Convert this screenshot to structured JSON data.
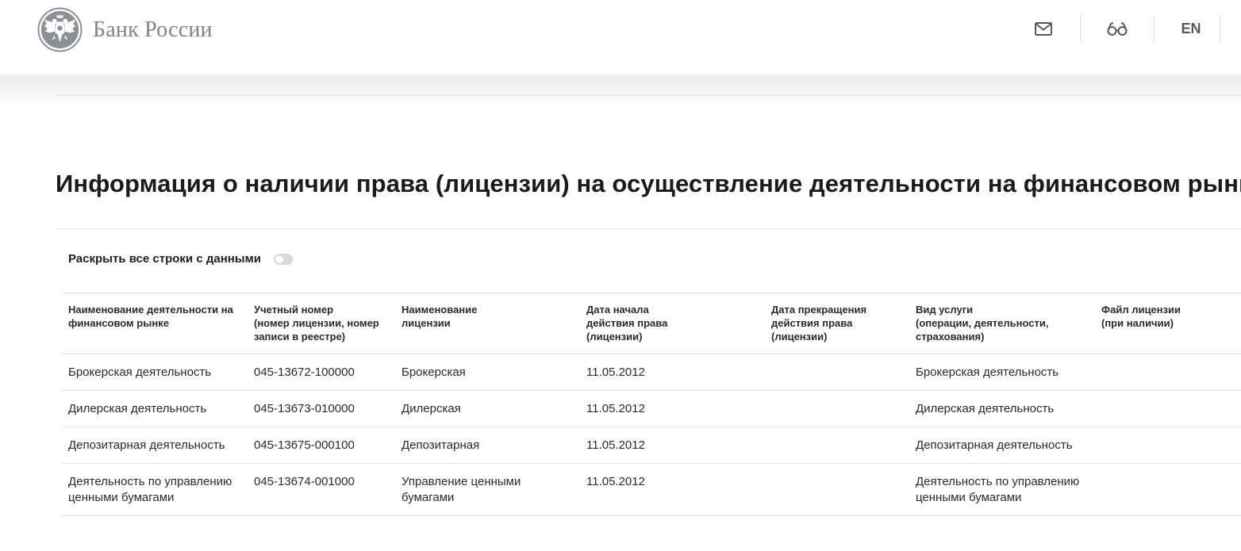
{
  "header": {
    "brand_name": "Банк России",
    "logo_icon": "double-headed-eagle-emblem",
    "actions": {
      "mail_icon": "envelope-icon",
      "accessibility_icon": "glasses-icon",
      "language_label": "EN"
    }
  },
  "page": {
    "title": "Информация о наличии права (лицензии) на осуществление деятельности на финансовом рынке"
  },
  "toggle": {
    "label": "Раскрыть все строки с данными",
    "checked": false
  },
  "table": {
    "columns": [
      "Наименование деятельности на\nфинансовом рынке",
      "Учетный номер\n(номер лицензии, номер\nзаписи в реестре)",
      "Наименование\nлицензии",
      "Дата начала\nдействия права\n(лицензии)",
      "Дата прекращения\nдействия права\n(лицензии)",
      "Вид услуги\n(операции, деятельности,\nстрахования)",
      "Файл лицензии\n(при наличии)"
    ],
    "rows": [
      [
        "Брокерская деятельность",
        "045-13672-100000",
        "Брокерская",
        "11.05.2012",
        "",
        "Брокерская деятельность",
        ""
      ],
      [
        "Дилерская деятельность",
        "045-13673-010000",
        "Дилерская",
        "11.05.2012",
        "",
        "Дилерская деятельность",
        ""
      ],
      [
        "Депозитарная деятельность",
        "045-13675-000100",
        "Депозитарная",
        "11.05.2012",
        "",
        "Депозитарная деятельность",
        ""
      ],
      [
        "Деятельность по управлению ценными бумагами",
        "045-13674-001000",
        "Управление ценными бумагами",
        "11.05.2012",
        "",
        "Деятельность по управлению ценными бумагами",
        ""
      ]
    ]
  },
  "colors": {
    "brand_gray": "#7f848b",
    "divider": "#e2e3e5",
    "toggle_off": "#d6d8db"
  }
}
